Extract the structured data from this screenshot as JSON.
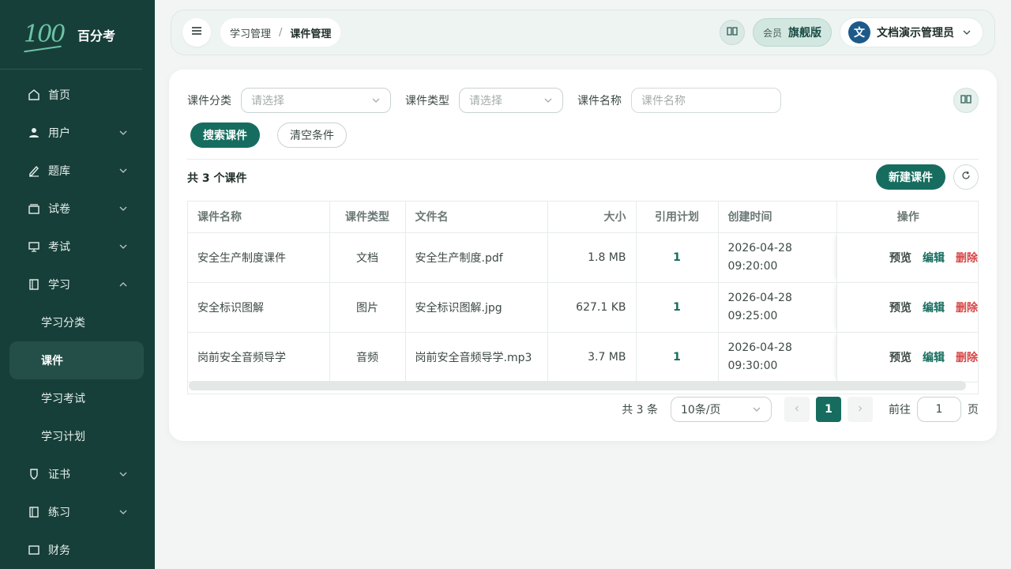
{
  "brand": {
    "logo_text": "100",
    "name": "百分考"
  },
  "sidebar": {
    "items": [
      {
        "label": "首页",
        "icon": "home-icon"
      },
      {
        "label": "用户",
        "icon": "user-icon"
      },
      {
        "label": "题库",
        "icon": "pen-icon"
      },
      {
        "label": "试卷",
        "icon": "paper-stack-icon"
      },
      {
        "label": "考试",
        "icon": "monitor-icon"
      },
      {
        "label": "学习",
        "icon": "book-icon"
      },
      {
        "label": "证书",
        "icon": "certificate-icon"
      },
      {
        "label": "练习",
        "icon": "book-icon"
      },
      {
        "label": "财务",
        "icon": "finance-icon"
      }
    ],
    "sub_items": [
      "学习分类",
      "课件",
      "学习考试",
      "学习计划"
    ]
  },
  "header": {
    "breadcrumb": [
      "学习管理",
      "课件管理"
    ],
    "breadcrumb_sep": "/",
    "vip_label": "会员",
    "vip_level": "旗舰版",
    "avatar_initial": "文",
    "user_name": "文档演示管理员"
  },
  "filters": {
    "category_label": "课件分类",
    "category_placeholder": "请选择",
    "type_label": "课件类型",
    "type_placeholder": "请选择",
    "name_label": "课件名称",
    "name_placeholder": "课件名称",
    "search_button": "搜索课件",
    "clear_button": "清空条件"
  },
  "summary": {
    "count_text": "共 3 个课件",
    "new_button": "新建课件"
  },
  "table": {
    "headers": [
      "课件名称",
      "课件类型",
      "文件名",
      "大小",
      "引用计划",
      "创建时间",
      "操作"
    ],
    "rows": [
      {
        "name": "安全生产制度课件",
        "type": "文档",
        "file": "安全生产制度.pdf",
        "size": "1.8 MB",
        "refs": "1",
        "date": "2026-04-28",
        "time": "09:20:00"
      },
      {
        "name": "安全标识图解",
        "type": "图片",
        "file": "安全标识图解.jpg",
        "size": "627.1 KB",
        "refs": "1",
        "date": "2026-04-28",
        "time": "09:25:00"
      },
      {
        "name": "岗前安全音频导学",
        "type": "音频",
        "file": "岗前安全音频导学.mp3",
        "size": "3.7 MB",
        "refs": "1",
        "date": "2026-04-28",
        "time": "09:30:00"
      }
    ],
    "actions": {
      "preview": "预览",
      "edit": "编辑",
      "delete": "删除"
    }
  },
  "pagination": {
    "total_text": "共 3 条",
    "page_size": "10条/页",
    "current_page": "1",
    "goto_label": "前往",
    "goto_value": "1",
    "page_word": "页"
  },
  "colors": {
    "sidebar_bg": "#173f39",
    "accent": "#166d5f",
    "danger": "#d64545"
  }
}
